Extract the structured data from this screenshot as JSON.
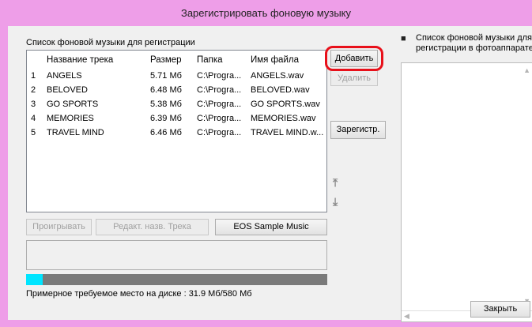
{
  "window": {
    "title": "Зарегистрировать фоновую музыку"
  },
  "left_panel": {
    "list_label": "Список фоновой музыки для регистрации",
    "columns": [
      "Название трека",
      "Размер",
      "Папка",
      "Имя файла"
    ],
    "rows": [
      {
        "num": "1",
        "name": "ANGELS",
        "size": "5.71 Мб",
        "folder": "C:\\Progra...",
        "file": "ANGELS.wav"
      },
      {
        "num": "2",
        "name": "BELOVED",
        "size": "6.48 Мб",
        "folder": "C:\\Progra...",
        "file": "BELOVED.wav"
      },
      {
        "num": "3",
        "name": "GO SPORTS",
        "size": "5.38 Мб",
        "folder": "C:\\Progra...",
        "file": "GO SPORTS.wav"
      },
      {
        "num": "4",
        "name": "MEMORIES",
        "size": "6.39 Мб",
        "folder": "C:\\Progra...",
        "file": "MEMORIES.wav"
      },
      {
        "num": "5",
        "name": "TRAVEL MIND",
        "size": "6.46 Мб",
        "folder": "C:\\Progra...",
        "file": "TRAVEL MIND.w..."
      }
    ],
    "play_button": "Проигрывать",
    "edit_name_button": "Редакт. назв. Трека",
    "eos_sample_button": "EOS Sample Music",
    "disk_space_text": "Примерное требуемое место на диске : 31.9 Мб/580 Мб",
    "disk_usage_fraction": 0.055,
    "disk_usage_color": "#00e5ff"
  },
  "actions": {
    "add_button": "Добавить",
    "delete_button": "Удалить",
    "register_button": "Зарегистр.",
    "highlight_color": "#e8101a"
  },
  "right_panel": {
    "title_line1": "Список фоновой музыки для",
    "title_line2": "регистрации в фотоаппарате",
    "camera_icon": "camera-icon"
  },
  "footer": {
    "close_button": "Закрыть"
  }
}
